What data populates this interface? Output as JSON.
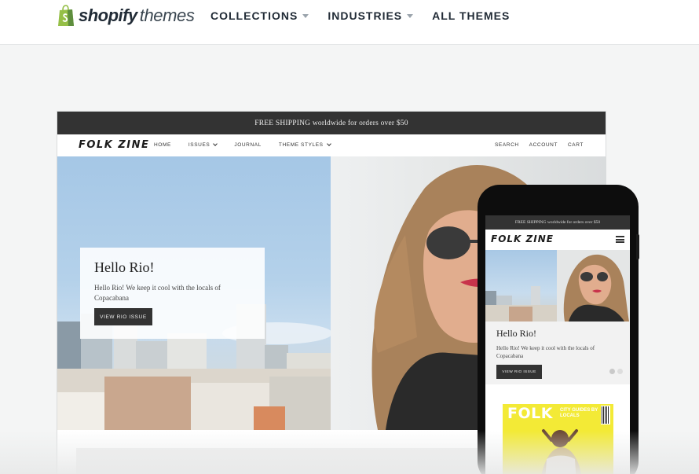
{
  "header": {
    "logo_brand": "shopify",
    "logo_sub": "themes",
    "nav": [
      {
        "label": "COLLECTIONS"
      },
      {
        "label": "INDUSTRIES"
      },
      {
        "label": "ALL THEMES"
      }
    ]
  },
  "desktop_preview": {
    "shipping_banner": "FREE SHIPPING worldwide for orders over $50",
    "store_logo": "FOLK ZINE",
    "store_nav": [
      "HOME",
      "ISSUES",
      "JOURNAL",
      "THEME STYLES"
    ],
    "store_nav_right": [
      "SEARCH",
      "ACCOUNT",
      "CART"
    ],
    "hero": {
      "title": "Hello Rio!",
      "text": "Hello Rio! We keep it cool with the locals of Copacabana",
      "button": "VIEW RIO ISSUE"
    }
  },
  "mobile_preview": {
    "shipping_banner": "FREE SHIPPING worldwide for orders over $50",
    "store_logo": "FOLK ZINE",
    "hero": {
      "title": "Hello Rio!",
      "text": "Hello Rio! We keep it cool with the locals of Copacabana",
      "button": "VIEW RIO ISSUE"
    },
    "magazine": {
      "title": "FOLK",
      "side_text": "CITY GUIDES BY LOCALS"
    }
  },
  "colors": {
    "shopify_green": "#95bf47",
    "dark_bar": "#333333",
    "text_dark": "#212b36"
  }
}
